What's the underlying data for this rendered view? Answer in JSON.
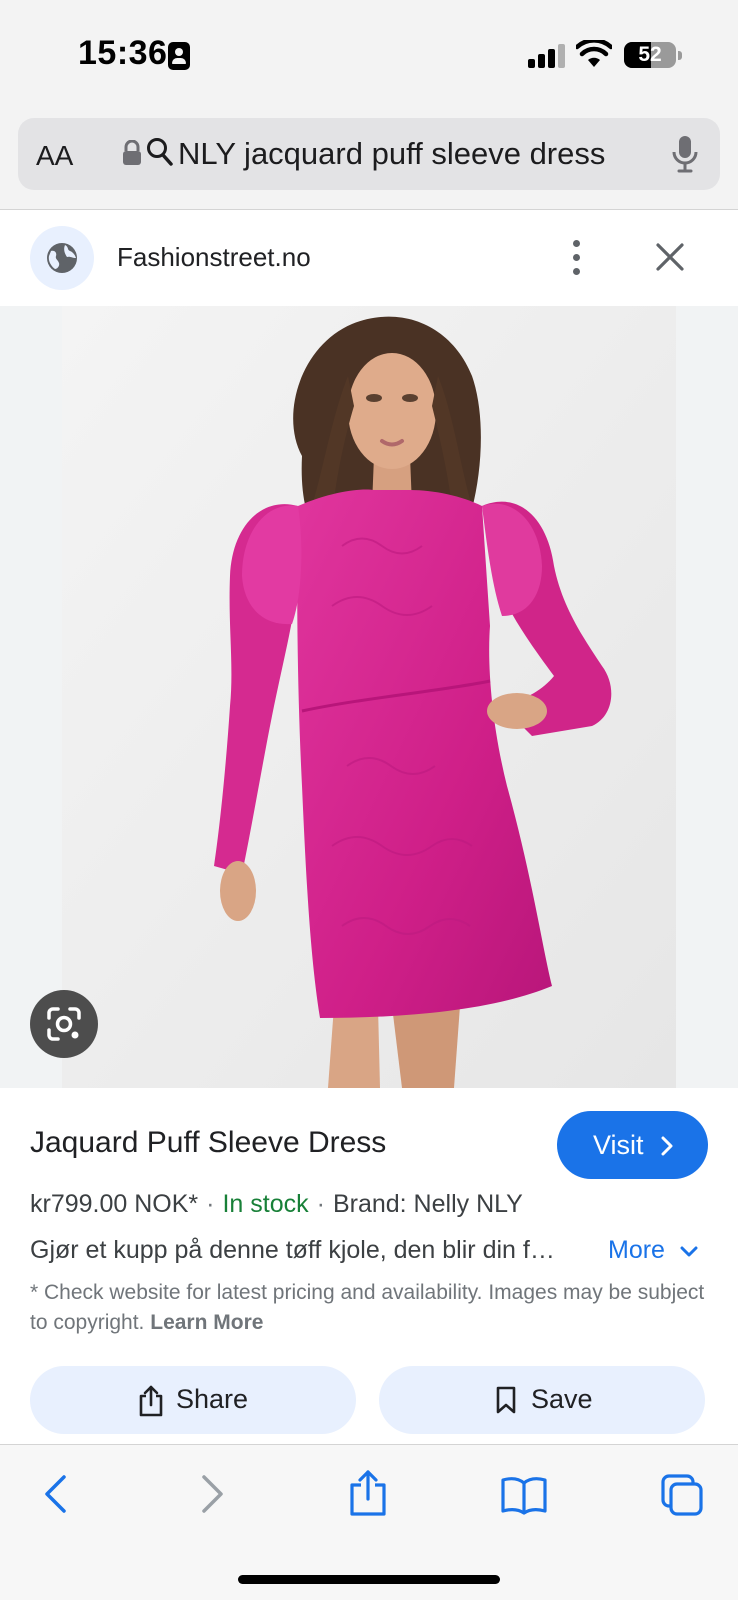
{
  "status_bar": {
    "time": "15:36",
    "battery": "52",
    "battery_level": 0.52
  },
  "url_bar": {
    "text_size_label": "AA",
    "query": "NLY jacquard puff sleeve dress"
  },
  "site": {
    "name": "Fashionstreet.no"
  },
  "product": {
    "title": "Jaquard Puff Sleeve Dress",
    "visit_label": "Visit",
    "price": "kr799.00 NOK*",
    "separator": "·",
    "stock": "In stock",
    "brand": "Brand: Nelly NLY",
    "description": "Gjør et kupp på denne tøff kjole, den blir din f…",
    "more_label": "More",
    "disclaimer": "* Check website for latest pricing and availability. Images may be subject to copyright.",
    "learn_more_label": "Learn More"
  },
  "actions": {
    "share_label": "Share",
    "save_label": "Save"
  },
  "colors": {
    "accent": "#1a73e8",
    "in_stock": "#188038",
    "dress": "#d3268f"
  }
}
